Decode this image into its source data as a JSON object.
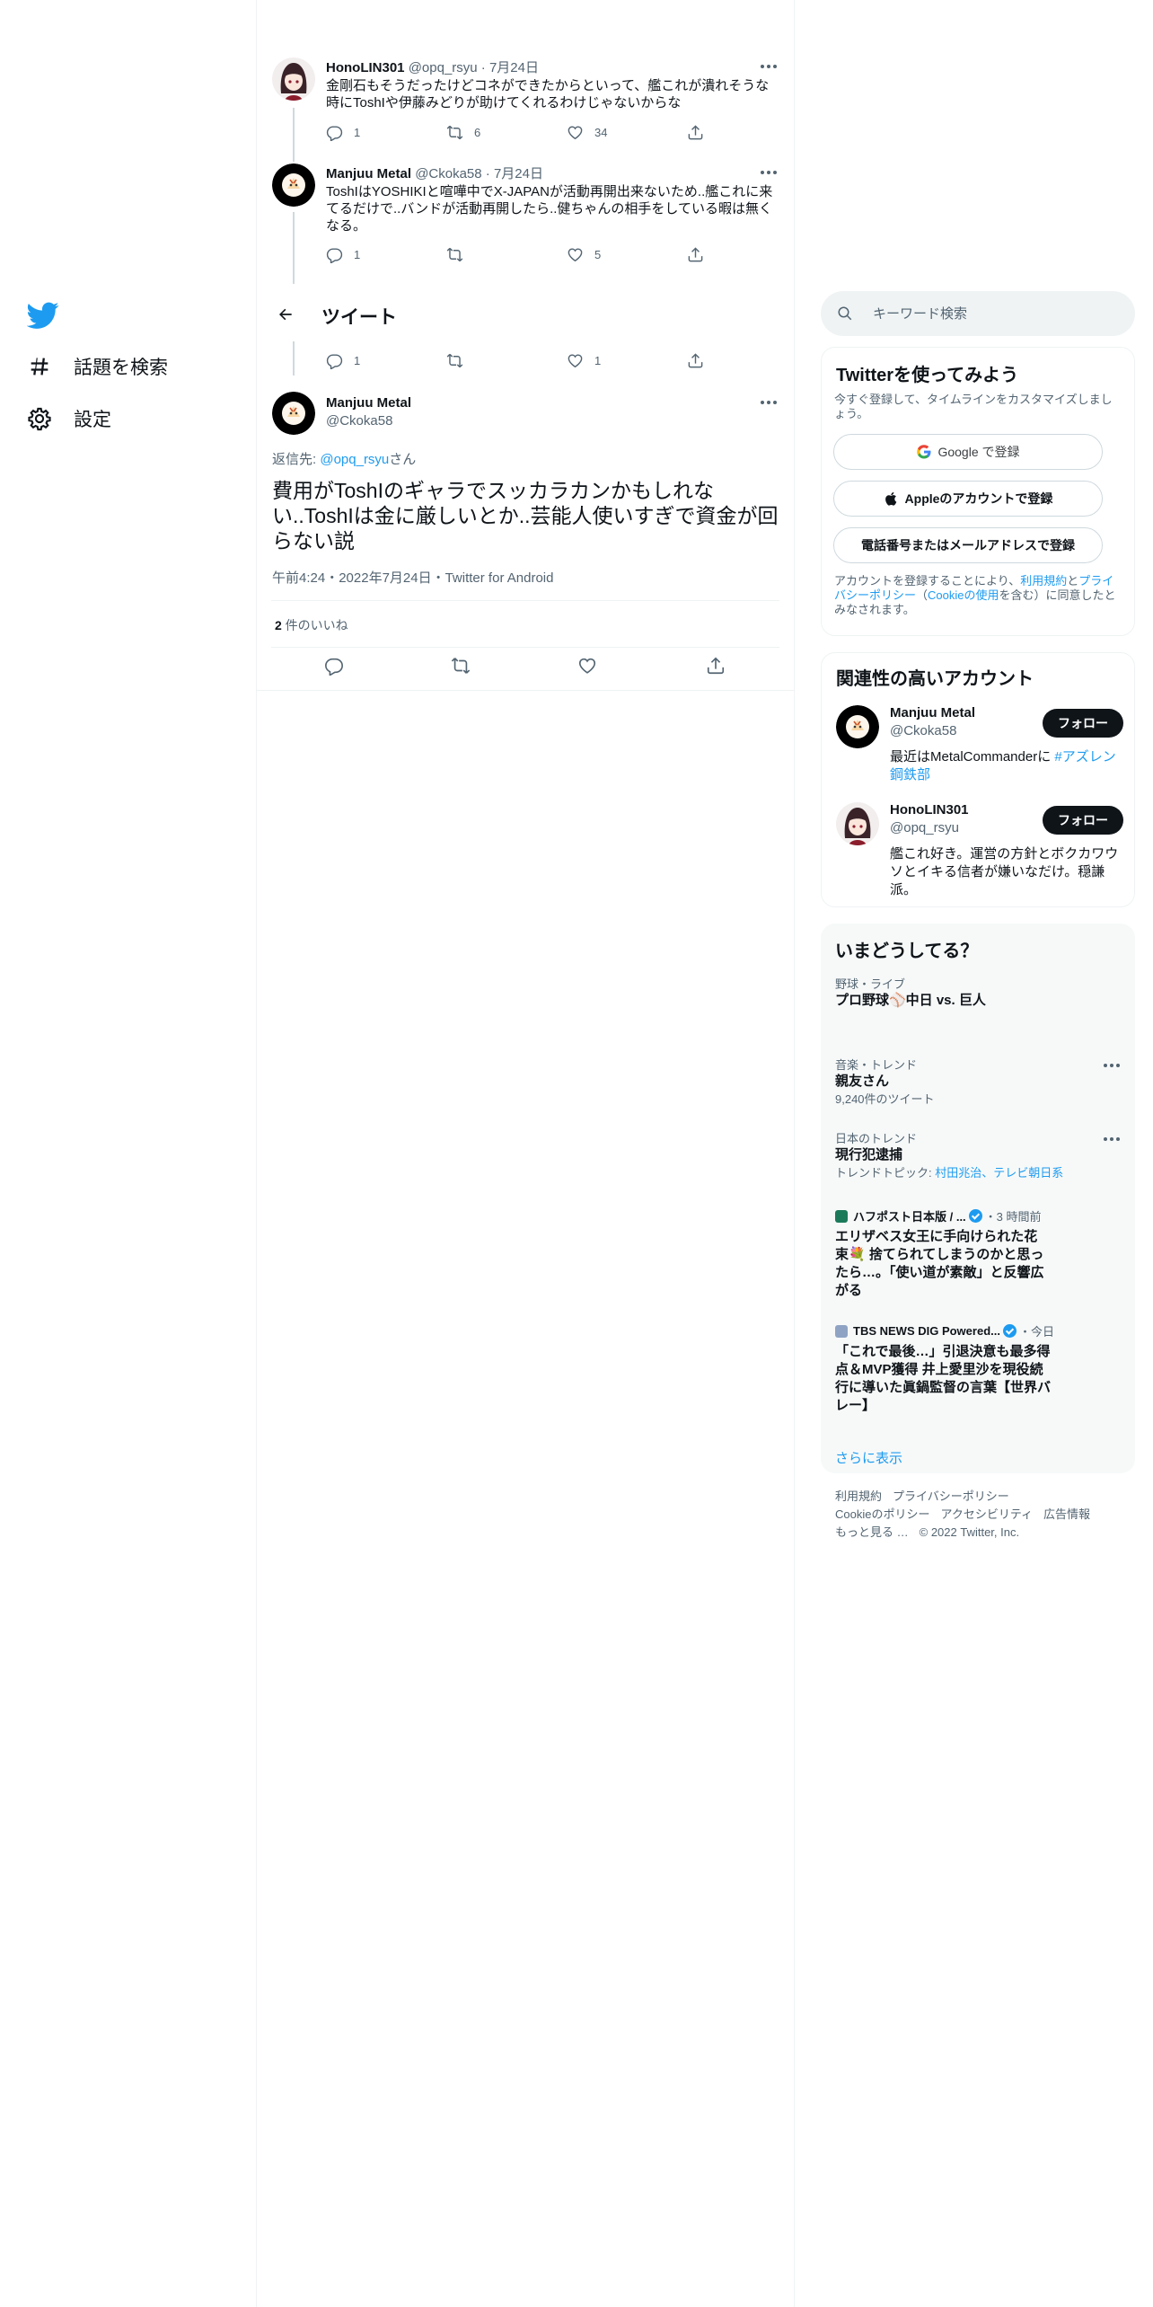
{
  "nav": {
    "explore_label": "話題を検索",
    "settings_label": "設定"
  },
  "header": {
    "title": "ツイート"
  },
  "thread": [
    {
      "name": "HonoLIN301",
      "handle": "@opq_rsyu",
      "date": "7月24日",
      "text": "金剛石もそうだったけどコネができたからといって、艦これが潰れそうな時にToshIや伊藤みどりが助けてくれるわけじゃないからな",
      "replies": "1",
      "retweets": "6",
      "likes": "34"
    },
    {
      "name": "Manjuu Metal",
      "handle": "@Ckoka58",
      "date": "7月24日",
      "text": "ToshIはYOSHIKIと喧嘩中でX-JAPANが活動再開出来ないため..艦これに来てるだけで..バンドが活動再開したら..健ちゃんの相手をしている暇は無くなる。",
      "replies": "1",
      "retweets": "",
      "likes": "5"
    },
    {
      "name": "",
      "handle": "",
      "date": "",
      "text": "",
      "replies": "1",
      "retweets": "",
      "likes": "1"
    }
  ],
  "main_tweet": {
    "name": "Manjuu Metal",
    "handle": "@Ckoka58",
    "reply_prefix": "返信先: ",
    "reply_handle": "@opq_rsyu",
    "reply_suffix": "さん",
    "text": "費用がToshIのギャラでスッカラカンかもしれない..ToshIは金に厳しいとか..芸能人使いすぎで資金が回らない説",
    "meta": "午前4:24・2022年7月24日・Twitter for Android",
    "like_count": "2",
    "like_label": " 件のいいね"
  },
  "search": {
    "placeholder": "キーワード検索"
  },
  "signup": {
    "title": "Twitterを使ってみよう",
    "desc": "今すぐ登録して、タイムラインをカスタマイズしましょう。",
    "google": "Google で登録",
    "apple": "Appleのアカウントで登録",
    "phone": "電話番号またはメールアドレスで登録",
    "terms_1": "アカウントを登録することにより、",
    "terms_link1": "利用規約",
    "terms_2": "と",
    "terms_link2": "プライバシーポリシー",
    "terms_3": "（",
    "terms_link3": "Cookieの使用",
    "terms_4": "を含む）に同意したとみなされます。"
  },
  "related": {
    "title": "関連性の高いアカウント",
    "accounts": [
      {
        "name": "Manjuu Metal",
        "handle": "@Ckoka58",
        "bio": "最近はMetalCommanderに ",
        "bio_link": "#アズレン鋼鉄部",
        "follow": "フォロー"
      },
      {
        "name": "HonoLIN301",
        "handle": "@opq_rsyu",
        "bio": "艦これ好き。運営の方針とボクカワウソとイキる信者が嫌いなだけ。穏謙派。",
        "bio_link": "",
        "follow": "フォロー"
      }
    ]
  },
  "trends": {
    "title": "いまどうしてる？",
    "items": [
      {
        "category": "野球・ライブ",
        "title": "プロ野球⚾中日 vs. 巨人",
        "sub": ""
      },
      {
        "category": "音楽・トレンド",
        "title": "親友さん",
        "sub": "9,240件のツイート"
      },
      {
        "category": "日本のトレンド",
        "title": "現行犯逮捕",
        "sub_prefix": "トレンドトピック: ",
        "sub_link": "村田兆治、テレビ朝日系"
      }
    ],
    "news": [
      {
        "source": "ハフポスト日本版 / ...",
        "time": "・3 時間前",
        "title": "エリザベス女王に手向けられた花束💐 捨てられてしまうのかと思ったら…。「使い道が素敵」と反響広がる"
      },
      {
        "source": "TBS NEWS DIG Powered...",
        "time": "・今日",
        "title": "「これで最後…」引退決意も最多得点＆MVP獲得 井上愛里沙を現役続行に導いた眞鍋監督の言葉【世界バレー】"
      }
    ],
    "show_more": "さらに表示"
  },
  "footer": {
    "links": [
      "利用規約",
      "プライバシーポリシー",
      "Cookieのポリシー",
      "アクセシビリティ",
      "広告情報",
      "もっと見る …"
    ],
    "copyright": "© 2022 Twitter, Inc."
  },
  "colors": {
    "accent": "#1d9bf0",
    "text": "#0f1419",
    "muted": "#536471",
    "border": "#eff3f4"
  }
}
